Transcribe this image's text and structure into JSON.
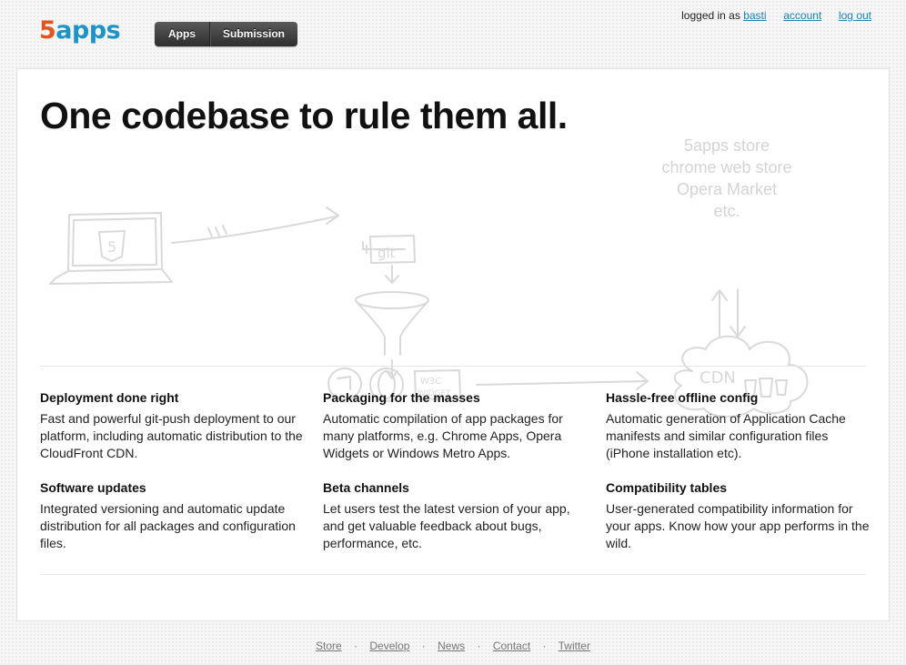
{
  "logo": {
    "five": "5",
    "apps": "apps"
  },
  "nav": {
    "apps": "Apps",
    "submission": "Submission"
  },
  "user": {
    "logged_in_as": "logged in as",
    "username": "basti",
    "account": "account",
    "logout": "log out"
  },
  "hero": {
    "headline": "One codebase to rule them all.",
    "sketch_labels": {
      "git": "git",
      "html5": "5",
      "widget_top": "W3C",
      "widget_bottom": "WIDGET",
      "cdn": "CDN"
    },
    "stores": [
      "5apps store",
      "chrome web store",
      "Opera Market",
      "etc."
    ]
  },
  "features": [
    {
      "title": "Deployment done right",
      "text": "Fast and powerful git-push deployment to our platform, including automatic distribution to the CloudFront CDN."
    },
    {
      "title": "Packaging for the masses",
      "text": "Automatic compilation of app packages for many platforms, e.g. Chrome Apps, Opera Widgets or Windows Metro Apps."
    },
    {
      "title": "Hassle-free offline config",
      "text": "Automatic generation of Application Cache manifests and similar configuration files (iPhone installation etc)."
    },
    {
      "title": "Software updates",
      "text": "Integrated versioning and automatic update distribution for all packages and configuration files."
    },
    {
      "title": "Beta channels",
      "text": "Let users test the latest version of your app, and get valuable feedback about bugs, performance, etc."
    },
    {
      "title": "Compatibility tables",
      "text": "User-generated compatibility information for your apps. Know how your app performs in the wild."
    }
  ],
  "footer": {
    "links": [
      "Store",
      "Develop",
      "News",
      "Contact",
      "Twitter"
    ],
    "separator": "·"
  },
  "colors": {
    "logo_five": "#e4541f",
    "logo_apps": "#1d93c6",
    "link": "#1a83b4",
    "nav_bg": "#3a3a3a"
  }
}
